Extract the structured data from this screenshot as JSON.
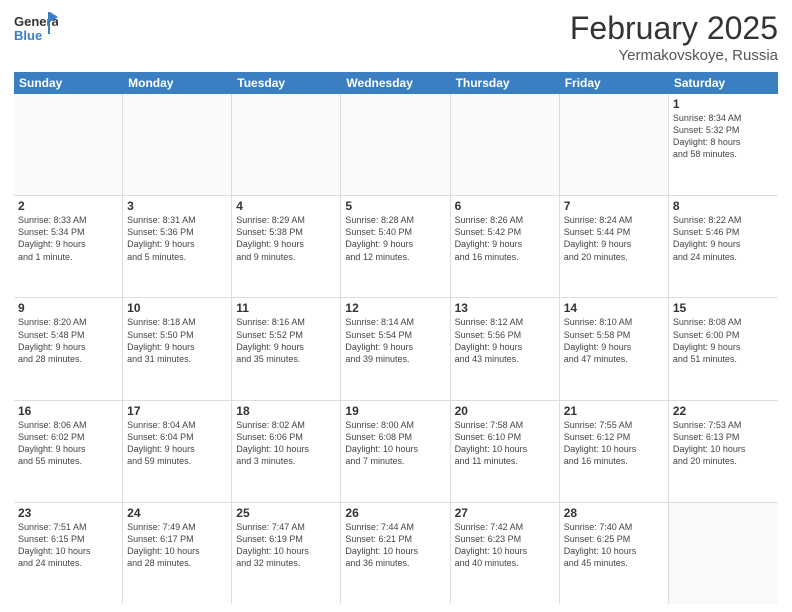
{
  "header": {
    "logo_general": "General",
    "logo_blue": "Blue",
    "month_year": "February 2025",
    "location": "Yermakovskoye, Russia"
  },
  "weekdays": [
    "Sunday",
    "Monday",
    "Tuesday",
    "Wednesday",
    "Thursday",
    "Friday",
    "Saturday"
  ],
  "rows": [
    [
      {
        "day": "",
        "info": ""
      },
      {
        "day": "",
        "info": ""
      },
      {
        "day": "",
        "info": ""
      },
      {
        "day": "",
        "info": ""
      },
      {
        "day": "",
        "info": ""
      },
      {
        "day": "",
        "info": ""
      },
      {
        "day": "1",
        "info": "Sunrise: 8:34 AM\nSunset: 5:32 PM\nDaylight: 8 hours\nand 58 minutes."
      }
    ],
    [
      {
        "day": "2",
        "info": "Sunrise: 8:33 AM\nSunset: 5:34 PM\nDaylight: 9 hours\nand 1 minute."
      },
      {
        "day": "3",
        "info": "Sunrise: 8:31 AM\nSunset: 5:36 PM\nDaylight: 9 hours\nand 5 minutes."
      },
      {
        "day": "4",
        "info": "Sunrise: 8:29 AM\nSunset: 5:38 PM\nDaylight: 9 hours\nand 9 minutes."
      },
      {
        "day": "5",
        "info": "Sunrise: 8:28 AM\nSunset: 5:40 PM\nDaylight: 9 hours\nand 12 minutes."
      },
      {
        "day": "6",
        "info": "Sunrise: 8:26 AM\nSunset: 5:42 PM\nDaylight: 9 hours\nand 16 minutes."
      },
      {
        "day": "7",
        "info": "Sunrise: 8:24 AM\nSunset: 5:44 PM\nDaylight: 9 hours\nand 20 minutes."
      },
      {
        "day": "8",
        "info": "Sunrise: 8:22 AM\nSunset: 5:46 PM\nDaylight: 9 hours\nand 24 minutes."
      }
    ],
    [
      {
        "day": "9",
        "info": "Sunrise: 8:20 AM\nSunset: 5:48 PM\nDaylight: 9 hours\nand 28 minutes."
      },
      {
        "day": "10",
        "info": "Sunrise: 8:18 AM\nSunset: 5:50 PM\nDaylight: 9 hours\nand 31 minutes."
      },
      {
        "day": "11",
        "info": "Sunrise: 8:16 AM\nSunset: 5:52 PM\nDaylight: 9 hours\nand 35 minutes."
      },
      {
        "day": "12",
        "info": "Sunrise: 8:14 AM\nSunset: 5:54 PM\nDaylight: 9 hours\nand 39 minutes."
      },
      {
        "day": "13",
        "info": "Sunrise: 8:12 AM\nSunset: 5:56 PM\nDaylight: 9 hours\nand 43 minutes."
      },
      {
        "day": "14",
        "info": "Sunrise: 8:10 AM\nSunset: 5:58 PM\nDaylight: 9 hours\nand 47 minutes."
      },
      {
        "day": "15",
        "info": "Sunrise: 8:08 AM\nSunset: 6:00 PM\nDaylight: 9 hours\nand 51 minutes."
      }
    ],
    [
      {
        "day": "16",
        "info": "Sunrise: 8:06 AM\nSunset: 6:02 PM\nDaylight: 9 hours\nand 55 minutes."
      },
      {
        "day": "17",
        "info": "Sunrise: 8:04 AM\nSunset: 6:04 PM\nDaylight: 9 hours\nand 59 minutes."
      },
      {
        "day": "18",
        "info": "Sunrise: 8:02 AM\nSunset: 6:06 PM\nDaylight: 10 hours\nand 3 minutes."
      },
      {
        "day": "19",
        "info": "Sunrise: 8:00 AM\nSunset: 6:08 PM\nDaylight: 10 hours\nand 7 minutes."
      },
      {
        "day": "20",
        "info": "Sunrise: 7:58 AM\nSunset: 6:10 PM\nDaylight: 10 hours\nand 11 minutes."
      },
      {
        "day": "21",
        "info": "Sunrise: 7:55 AM\nSunset: 6:12 PM\nDaylight: 10 hours\nand 16 minutes."
      },
      {
        "day": "22",
        "info": "Sunrise: 7:53 AM\nSunset: 6:13 PM\nDaylight: 10 hours\nand 20 minutes."
      }
    ],
    [
      {
        "day": "23",
        "info": "Sunrise: 7:51 AM\nSunset: 6:15 PM\nDaylight: 10 hours\nand 24 minutes."
      },
      {
        "day": "24",
        "info": "Sunrise: 7:49 AM\nSunset: 6:17 PM\nDaylight: 10 hours\nand 28 minutes."
      },
      {
        "day": "25",
        "info": "Sunrise: 7:47 AM\nSunset: 6:19 PM\nDaylight: 10 hours\nand 32 minutes."
      },
      {
        "day": "26",
        "info": "Sunrise: 7:44 AM\nSunset: 6:21 PM\nDaylight: 10 hours\nand 36 minutes."
      },
      {
        "day": "27",
        "info": "Sunrise: 7:42 AM\nSunset: 6:23 PM\nDaylight: 10 hours\nand 40 minutes."
      },
      {
        "day": "28",
        "info": "Sunrise: 7:40 AM\nSunset: 6:25 PM\nDaylight: 10 hours\nand 45 minutes."
      },
      {
        "day": "",
        "info": ""
      }
    ]
  ]
}
